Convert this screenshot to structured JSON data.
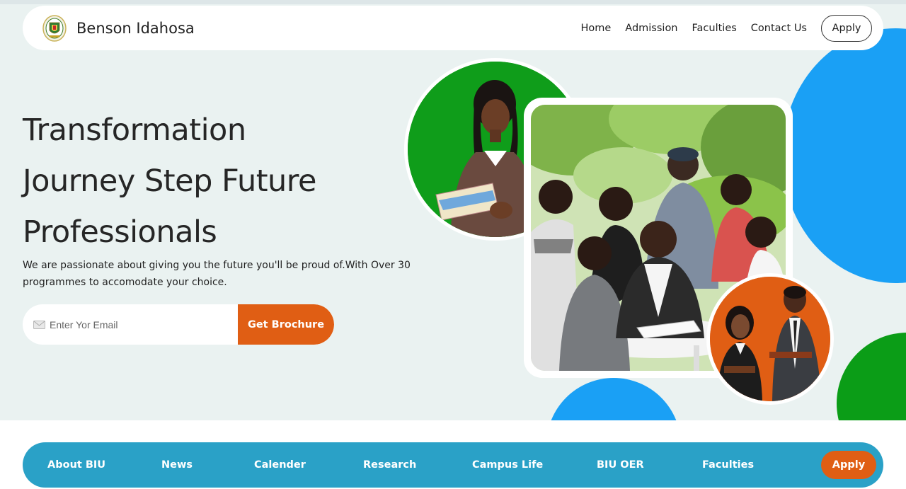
{
  "nav": {
    "brand": "Benson Idahosa",
    "links": [
      "Home",
      "Admission",
      "Faculties",
      "Contact Us"
    ],
    "apply_label": "Apply"
  },
  "hero": {
    "headline_lines": [
      "Transformation",
      "Journey Step Future",
      "Professionals"
    ],
    "subtext": "We are passionate about giving you the future you'll be proud of.With Over 30 programmes to accomodate your choice.",
    "email_placeholder": "Enter Yor Email",
    "brochure_label": "Get Brochure"
  },
  "icons": {
    "logo": "university-crest-logo",
    "mail": "envelope-icon"
  },
  "colors": {
    "accent_orange": "#e05e14",
    "accent_blue": "#1aa0f5",
    "accent_green": "#0b9d17",
    "bottom_nav": "#2aa1c7",
    "hero_bg": "#eaf2f1"
  },
  "bottom_nav": {
    "items": [
      "About BIU",
      "News",
      "Calender",
      "Research",
      "Campus Life",
      "BIU OER",
      "Faculties"
    ],
    "apply_label": "Apply"
  }
}
